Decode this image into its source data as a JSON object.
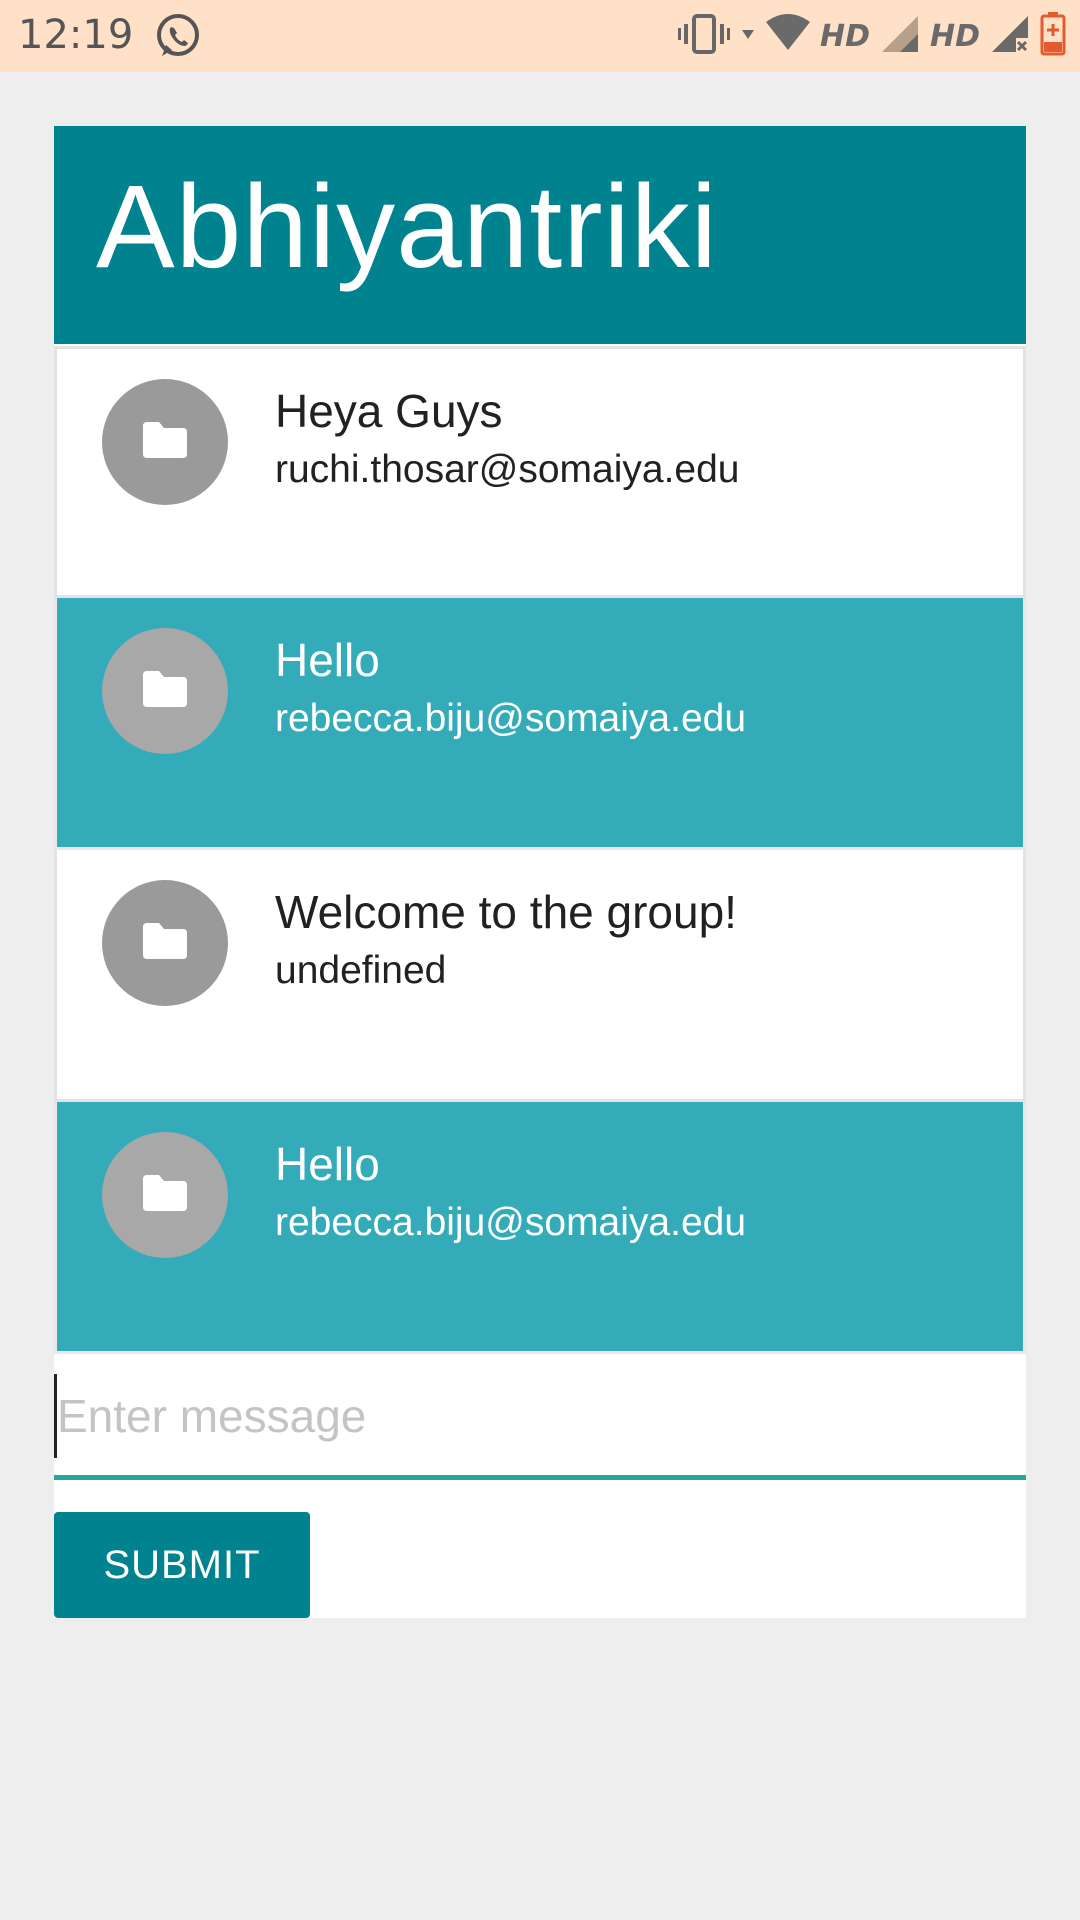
{
  "status_bar": {
    "time": "12:19",
    "network_labels": [
      "HD",
      "HD"
    ],
    "icons": [
      "whatsapp-icon",
      "vibrate-icon",
      "wifi-icon",
      "signal-icon",
      "signal-no-service-icon",
      "battery-low-icon"
    ]
  },
  "header": {
    "title": "Abhiyantriki",
    "color": "#00838f"
  },
  "messages": [
    {
      "body": "Heya Guys",
      "author": "ruchi.thosar@somaiya.edu",
      "style": "other"
    },
    {
      "body": "Hello",
      "author": "rebecca.biju@somaiya.edu",
      "style": "self"
    },
    {
      "body": "Welcome to the group!",
      "author": "undefined",
      "style": "other"
    },
    {
      "body": "Hello",
      "author": "rebecca.biju@somaiya.edu",
      "style": "self"
    }
  ],
  "composer": {
    "placeholder": "Enter message",
    "value": "",
    "submit_label": "SUBMIT",
    "underline_color": "#26a69a"
  },
  "colors": {
    "self_message_bg": "#33abb8",
    "other_message_bg": "#ffffff",
    "page_bg": "#eeeeee",
    "status_bar_bg": "#ffe1c8"
  }
}
